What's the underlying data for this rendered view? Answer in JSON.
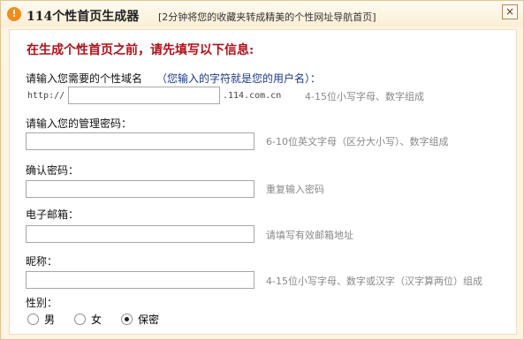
{
  "window": {
    "title": "114个性首页生成器",
    "subtitle": "[2分钟将您的收藏夹转成精美的个性网址导航首页]",
    "icon": "info-circle-icon",
    "icon_glyph": "!",
    "close_label": "×"
  },
  "form": {
    "heading": "在生成个性首页之前，请先填写以下信息:",
    "domain": {
      "label": "请输入您需要的个性域名",
      "note": "（您输入的字符就是您的用户名）：",
      "prefix": "http://",
      "value": "",
      "suffix": ".114.com.cn",
      "hint": "4-15位小写字母、数字组成"
    },
    "password": {
      "label": "请输入您的管理密码：",
      "value": "",
      "hint": "6-10位英文字母（区分大小写）、数字组成"
    },
    "confirm": {
      "label": "确认密码：",
      "value": "",
      "hint": "重复输入密码"
    },
    "email": {
      "label": "电子邮箱：",
      "value": "",
      "hint": "请填写有效邮箱地址"
    },
    "nickname": {
      "label": "昵称：",
      "value": "",
      "hint": "4-15位小写字母、数字或汉字（汉字算两位）组成"
    },
    "gender": {
      "label": "性别：",
      "options": [
        "男",
        "女",
        "保密"
      ],
      "selected": "保密"
    }
  },
  "colors": {
    "heading": "#b0111a",
    "note": "#1a3a8a",
    "icon": "#f28c1c"
  }
}
